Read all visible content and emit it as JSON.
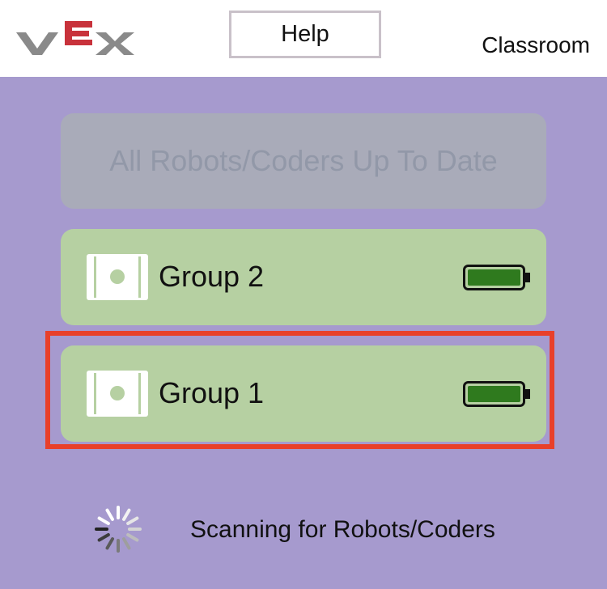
{
  "header": {
    "logo_name": "VEX",
    "help_label": "Help",
    "classroom_label": "Classroom"
  },
  "main": {
    "update_button_label": "All Robots/Coders Up To Date",
    "groups": [
      {
        "label": "Group 2",
        "battery_level": 1.0,
        "selected": false
      },
      {
        "label": "Group 1",
        "battery_level": 1.0,
        "selected": true
      }
    ],
    "scan_status": "Scanning for Robots/Coders"
  },
  "colors": {
    "background": "#a69ace",
    "group_row": "#b6d0a2",
    "update_button": "#a9abb9",
    "battery_fill": "#2f7a1e",
    "selection": "#e8402a",
    "logo_red": "#c8323b",
    "logo_gray": "#8a8a8a"
  },
  "icons": {
    "logo": "vex-logo-icon",
    "robot": "robot-brain-icon",
    "battery": "battery-full-icon",
    "spinner": "loading-spinner-icon"
  }
}
